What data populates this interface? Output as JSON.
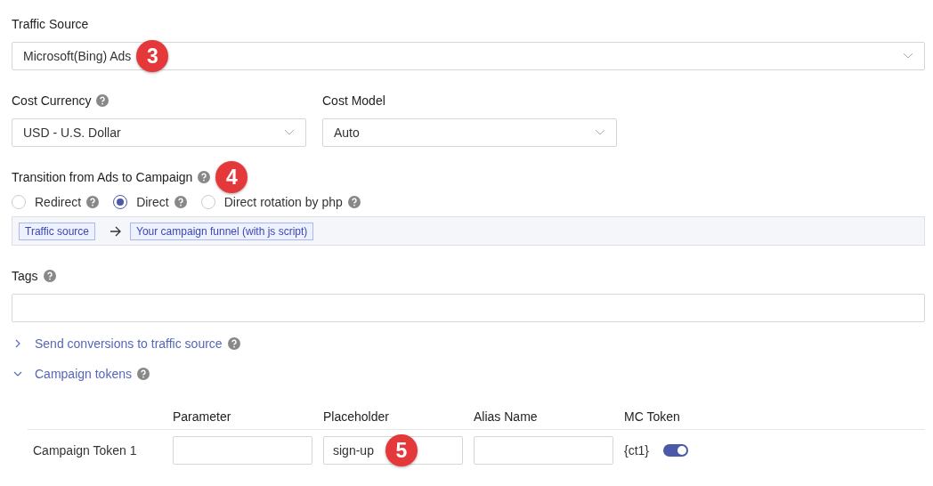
{
  "traffic_source": {
    "label": "Traffic Source",
    "value": "Microsoft(Bing) Ads",
    "callout": "3"
  },
  "cost_currency": {
    "label": "Cost Currency",
    "help": true,
    "value": "USD - U.S. Dollar"
  },
  "cost_model": {
    "label": "Cost Model",
    "value": "Auto"
  },
  "transition": {
    "label": "Transition from Ads to Campaign",
    "help": true,
    "callout": "4",
    "options": [
      {
        "label": "Redirect",
        "help": true,
        "selected": false
      },
      {
        "label": "Direct",
        "help": true,
        "selected": true
      },
      {
        "label": "Direct rotation by php",
        "help": true,
        "selected": false
      }
    ],
    "flow": [
      "Traffic source",
      "Your campaign funnel (with js script)"
    ]
  },
  "tags": {
    "label": "Tags",
    "help": true
  },
  "sections": [
    {
      "label": "Send conversions to traffic source",
      "help": true,
      "expanded": false
    },
    {
      "label": "Campaign tokens",
      "help": true,
      "expanded": true
    }
  ],
  "tokens": {
    "columns": [
      "Parameter",
      "Placeholder",
      "Alias Name",
      "MC Token"
    ],
    "rows": [
      {
        "name": "Campaign Token 1",
        "value": "sign-up",
        "callout": "5",
        "mc_token": "{ct1}",
        "on": true
      }
    ]
  }
}
